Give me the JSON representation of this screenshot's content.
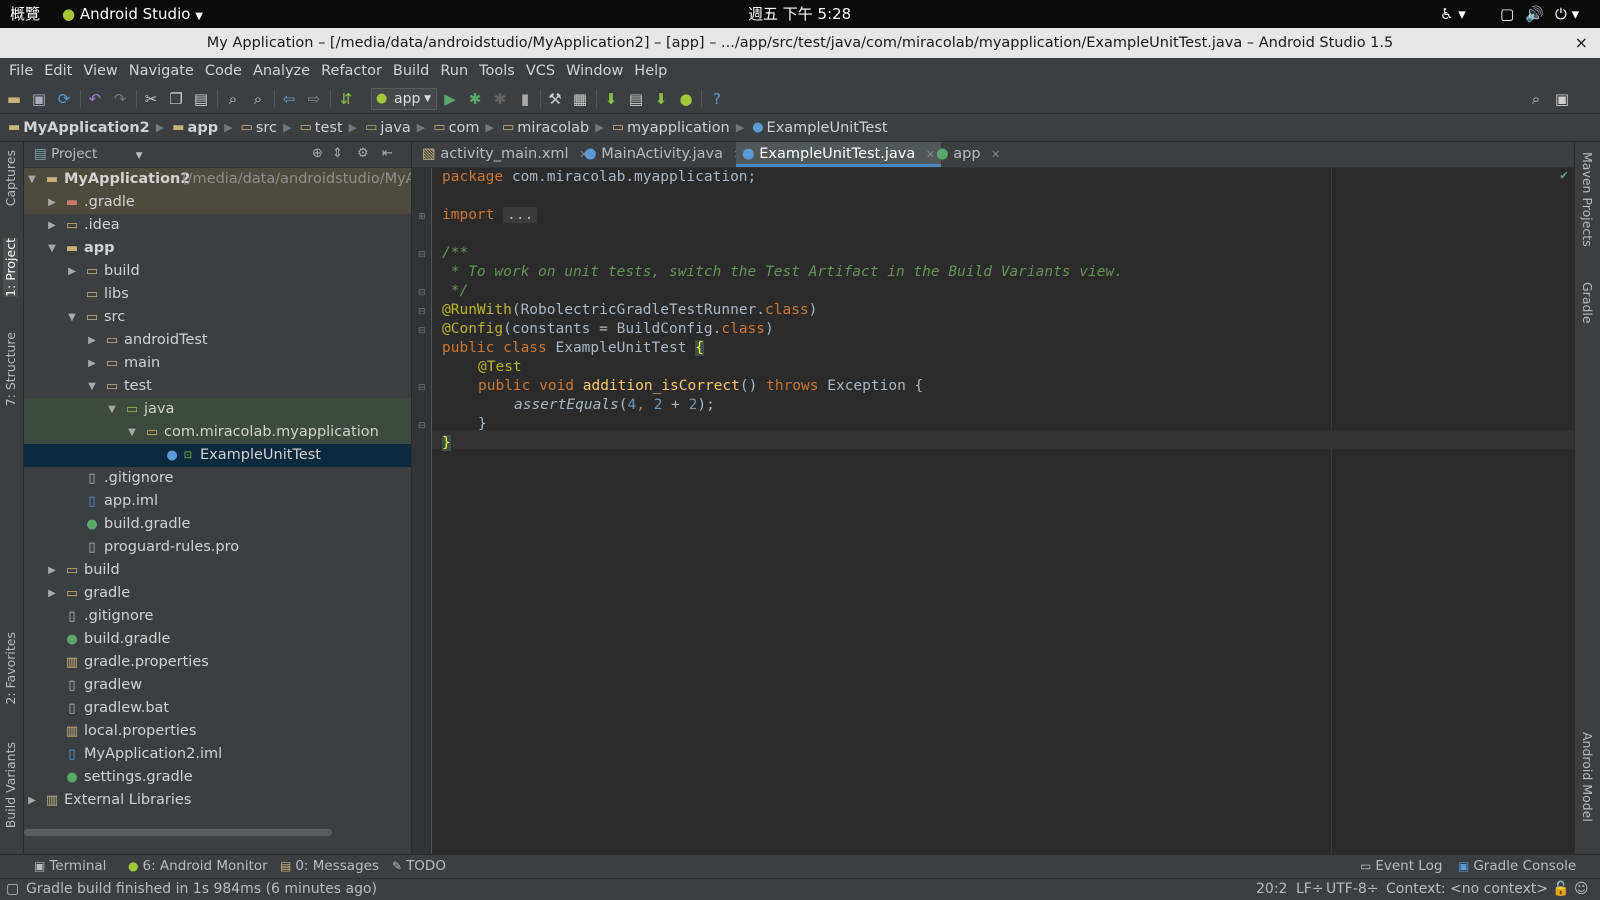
{
  "os_bar": {
    "overview": "概覽",
    "app_name": "Android Studio",
    "clock": "週五 下午 5:28"
  },
  "window": {
    "title": "My Application – [/media/data/androidstudio/MyApplication2] – [app] – .../app/src/test/java/com/miracolab/myapplication/ExampleUnitTest.java – Android Studio 1.5",
    "close": "×"
  },
  "menu": [
    {
      "label": "File"
    },
    {
      "label": "Edit"
    },
    {
      "label": "View"
    },
    {
      "label": "Navigate"
    },
    {
      "label": "Code"
    },
    {
      "label": "Analyze"
    },
    {
      "label": "Refactor"
    },
    {
      "label": "Build"
    },
    {
      "label": "Run"
    },
    {
      "label": "Tools"
    },
    {
      "label": "VCS"
    },
    {
      "label": "Window"
    },
    {
      "label": "Help"
    }
  ],
  "toolbar": {
    "run_config": "app",
    "help": "?"
  },
  "breadcrumb": [
    {
      "label": "MyApplication2"
    },
    {
      "label": "app"
    },
    {
      "label": "src"
    },
    {
      "label": "test"
    },
    {
      "label": "java"
    },
    {
      "label": "com"
    },
    {
      "label": "miracolab"
    },
    {
      "label": "myapplication"
    },
    {
      "label": "ExampleUnitTest"
    }
  ],
  "left_stripe": {
    "captures": "Captures",
    "project": "1: Project",
    "structure": "7: Structure",
    "favorites": "2: Favorites",
    "build_variants": "Build Variants"
  },
  "right_stripe": {
    "maven": "Maven Projects",
    "gradle": "Gradle",
    "android_model": "Android Model"
  },
  "project_panel": {
    "view_selector": "Project",
    "root_name": "MyApplication2",
    "root_path": "(/media/data/androidstudio/MyA",
    "tree": {
      "gradle_dir": ".gradle",
      "idea_dir": ".idea",
      "app": "app",
      "app_build": "build",
      "app_libs": "libs",
      "app_src": "src",
      "android_test": "androidTest",
      "main": "main",
      "test": "test",
      "java": "java",
      "package": "com.miracolab.myapplication",
      "example_unit_test": "ExampleUnitTest",
      "app_gitignore": ".gitignore",
      "app_iml": "app.iml",
      "app_build_gradle": "build.gradle",
      "proguard": "proguard-rules.pro",
      "build": "build",
      "gradle": "gradle",
      "gitignore": ".gitignore",
      "build_gradle": "build.gradle",
      "gradle_properties": "gradle.properties",
      "gradlew": "gradlew",
      "gradlew_bat": "gradlew.bat",
      "local_properties": "local.properties",
      "project_iml": "MyApplication2.iml",
      "settings_gradle": "settings.gradle",
      "external_libraries": "External Libraries"
    }
  },
  "editor": {
    "tabs": [
      {
        "label": "activity_main.xml"
      },
      {
        "label": "MainActivity.java"
      },
      {
        "label": "ExampleUnitTest.java"
      },
      {
        "label": "app"
      }
    ],
    "code": {
      "l_package_kw": "package",
      "l_package_name": " com.miracolab.myapplication;",
      "l_import_kw": "import",
      "l_import_fold": "...",
      "l_doc_open": "/**",
      "l_doc_body": " * To work on unit tests, switch the Test Artifact in the Build Variants view.",
      "l_doc_close": " */",
      "l_runwith_ann": "@RunWith",
      "l_runwith_arg": "(RobolectricGradleTestRunner.",
      "l_class_kw1": "class",
      "l_close_paren1": ")",
      "l_config_ann": "@Config",
      "l_config_arg": "(constants = BuildConfig.",
      "l_class_kw2": "class",
      "l_close_paren2": ")",
      "l_public_class": "public class",
      "l_class_name": " ExampleUnitTest ",
      "l_brace_open": "{",
      "l_test_ann": "@Test",
      "l_public_void": "public void",
      "l_method_name": " addition_isCorrect",
      "l_parens": "() ",
      "l_throws": "throws",
      "l_exception": " Exception {",
      "l_assert": "assertEquals",
      "l_paren_open": "(",
      "l_num4": "4",
      "l_comma": ", ",
      "l_num2a": "2",
      "l_plus": " + ",
      "l_num2b": "2",
      "l_end_call": ");",
      "l_inner_close": "}",
      "l_outer_close": "}"
    }
  },
  "tool_windows": {
    "terminal": "Terminal",
    "android_monitor": "6: Android Monitor",
    "messages": "0: Messages",
    "todo": "TODO",
    "event_log": "Event Log",
    "gradle_console": "Gradle Console"
  },
  "status": {
    "message": "Gradle build finished in 1s 984ms (6 minutes ago)",
    "position": "20:2",
    "line_sep": "LF÷",
    "encoding": "UTF-8÷",
    "context": "Context: <no context>"
  },
  "colors": {
    "editor_bg": "#2b2b2b",
    "panel_bg": "#3c3f41",
    "keyword": "#cc7832",
    "annotation": "#bbb529",
    "comment": "#629755",
    "number": "#6897bb",
    "method": "#ffc66d",
    "selection": "#0d293e"
  }
}
